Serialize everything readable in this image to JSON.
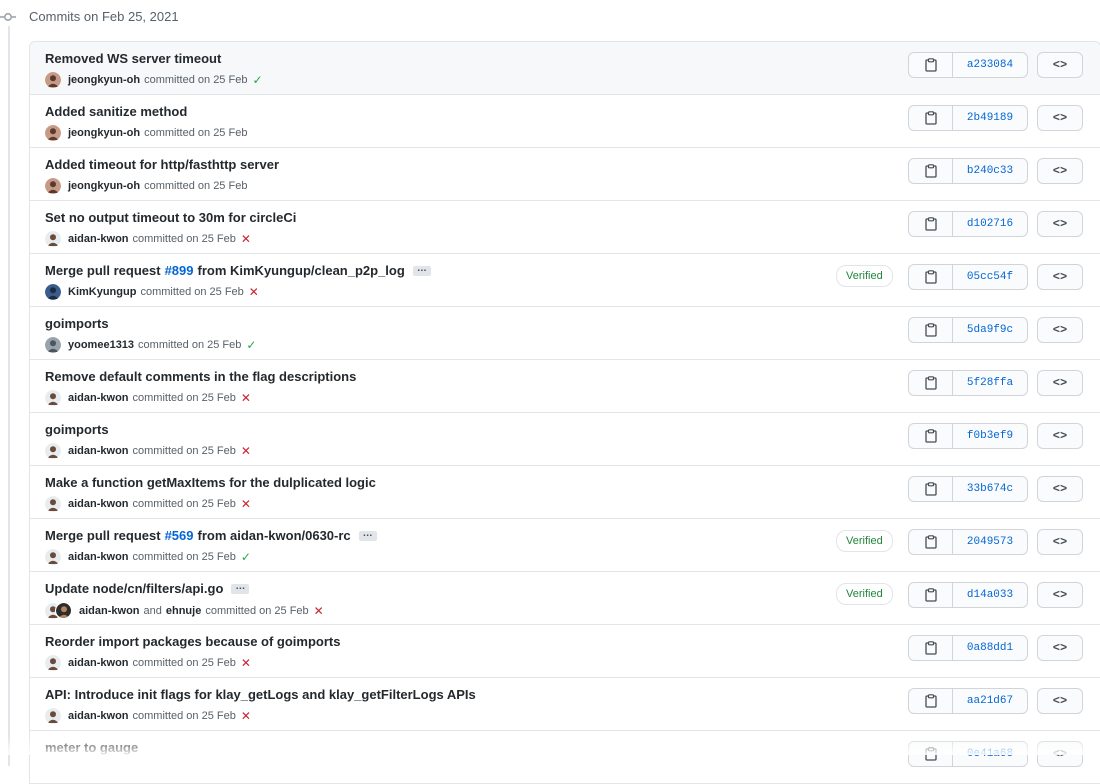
{
  "header": {
    "title": "Commits on Feb 25, 2021"
  },
  "commits": [
    {
      "title_parts": [
        "Removed WS server timeout"
      ],
      "pr": "",
      "title_after": "",
      "has_ellipsis": false,
      "authors": [
        "jeongkyun-oh"
      ],
      "meta_text": "committed on 25 Feb",
      "status": "success",
      "verified": "",
      "sha": "a233084"
    },
    {
      "title_parts": [
        "Added sanitize method"
      ],
      "pr": "",
      "title_after": "",
      "has_ellipsis": false,
      "authors": [
        "jeongkyun-oh"
      ],
      "meta_text": "committed on 25 Feb",
      "status": "none",
      "verified": "",
      "sha": "2b49189"
    },
    {
      "title_parts": [
        "Added timeout for http/fasthttp server"
      ],
      "pr": "",
      "title_after": "",
      "has_ellipsis": false,
      "authors": [
        "jeongkyun-oh"
      ],
      "meta_text": "committed on 25 Feb",
      "status": "none",
      "verified": "",
      "sha": "b240c33"
    },
    {
      "title_parts": [
        "Set no output timeout to 30m for circleCi"
      ],
      "pr": "",
      "title_after": "",
      "has_ellipsis": false,
      "authors": [
        "aidan-kwon"
      ],
      "meta_text": "committed on 25 Feb",
      "status": "failure",
      "verified": "",
      "sha": "d102716"
    },
    {
      "title_parts": [
        "Merge pull request"
      ],
      "pr": "#899",
      "title_after": "from KimKyungup/clean_p2p_log",
      "has_ellipsis": true,
      "authors": [
        "KimKyungup"
      ],
      "meta_text": "committed on 25 Feb",
      "status": "failure",
      "verified": "Verified",
      "sha": "05cc54f"
    },
    {
      "title_parts": [
        "goimports"
      ],
      "pr": "",
      "title_after": "",
      "has_ellipsis": false,
      "authors": [
        "yoomee1313"
      ],
      "meta_text": "committed on 25 Feb",
      "status": "success",
      "verified": "",
      "sha": "5da9f9c"
    },
    {
      "title_parts": [
        "Remove default comments in the flag descriptions"
      ],
      "pr": "",
      "title_after": "",
      "has_ellipsis": false,
      "authors": [
        "aidan-kwon"
      ],
      "meta_text": "committed on 25 Feb",
      "status": "failure",
      "verified": "",
      "sha": "5f28ffa"
    },
    {
      "title_parts": [
        "goimports"
      ],
      "pr": "",
      "title_after": "",
      "has_ellipsis": false,
      "authors": [
        "aidan-kwon"
      ],
      "meta_text": "committed on 25 Feb",
      "status": "failure",
      "verified": "",
      "sha": "f0b3ef9"
    },
    {
      "title_parts": [
        "Make a function getMaxItems for the dulplicated logic"
      ],
      "pr": "",
      "title_after": "",
      "has_ellipsis": false,
      "authors": [
        "aidan-kwon"
      ],
      "meta_text": "committed on 25 Feb",
      "status": "failure",
      "verified": "",
      "sha": "33b674c"
    },
    {
      "title_parts": [
        "Merge pull request"
      ],
      "pr": "#569",
      "title_after": "from aidan-kwon/0630-rc",
      "has_ellipsis": true,
      "authors": [
        "aidan-kwon"
      ],
      "meta_text": "committed on 25 Feb",
      "status": "success",
      "verified": "Verified",
      "sha": "2049573"
    },
    {
      "title_parts": [
        "Update node/cn/filters/api.go"
      ],
      "pr": "",
      "title_after": "",
      "has_ellipsis": true,
      "authors": [
        "aidan-kwon",
        "ehnuje"
      ],
      "and_text": "and",
      "meta_text": "committed on 25 Feb",
      "status": "failure",
      "verified": "Verified",
      "sha": "d14a033"
    },
    {
      "title_parts": [
        "Reorder import packages because of goimports"
      ],
      "pr": "",
      "title_after": "",
      "has_ellipsis": false,
      "authors": [
        "aidan-kwon"
      ],
      "meta_text": "committed on 25 Feb",
      "status": "failure",
      "verified": "",
      "sha": "0a88dd1"
    },
    {
      "title_parts": [
        "API: Introduce init flags for klay_getLogs and klay_getFilterLogs APIs"
      ],
      "pr": "",
      "title_after": "",
      "has_ellipsis": false,
      "authors": [
        "aidan-kwon"
      ],
      "meta_text": "committed on 25 Feb",
      "status": "failure",
      "verified": "",
      "sha": "aa21d67"
    },
    {
      "title_parts": [
        "meter to gauge"
      ],
      "pr": "",
      "title_after": "",
      "has_ellipsis": false,
      "authors": [],
      "meta_text": "",
      "status": "none",
      "verified": "",
      "sha": "0e41a68"
    }
  ],
  "browse_label": "<>",
  "ellipsis_label": "…",
  "status_glyphs": {
    "success": "✓",
    "failure": "✕"
  },
  "colors": {
    "link": "#0366d6",
    "success": "#28a745",
    "failure": "#cb2431",
    "border": "#e1e4e8"
  },
  "icons": {
    "copy": "clipboard-icon",
    "commit": "git-commit-icon",
    "browse": "code-icon"
  }
}
